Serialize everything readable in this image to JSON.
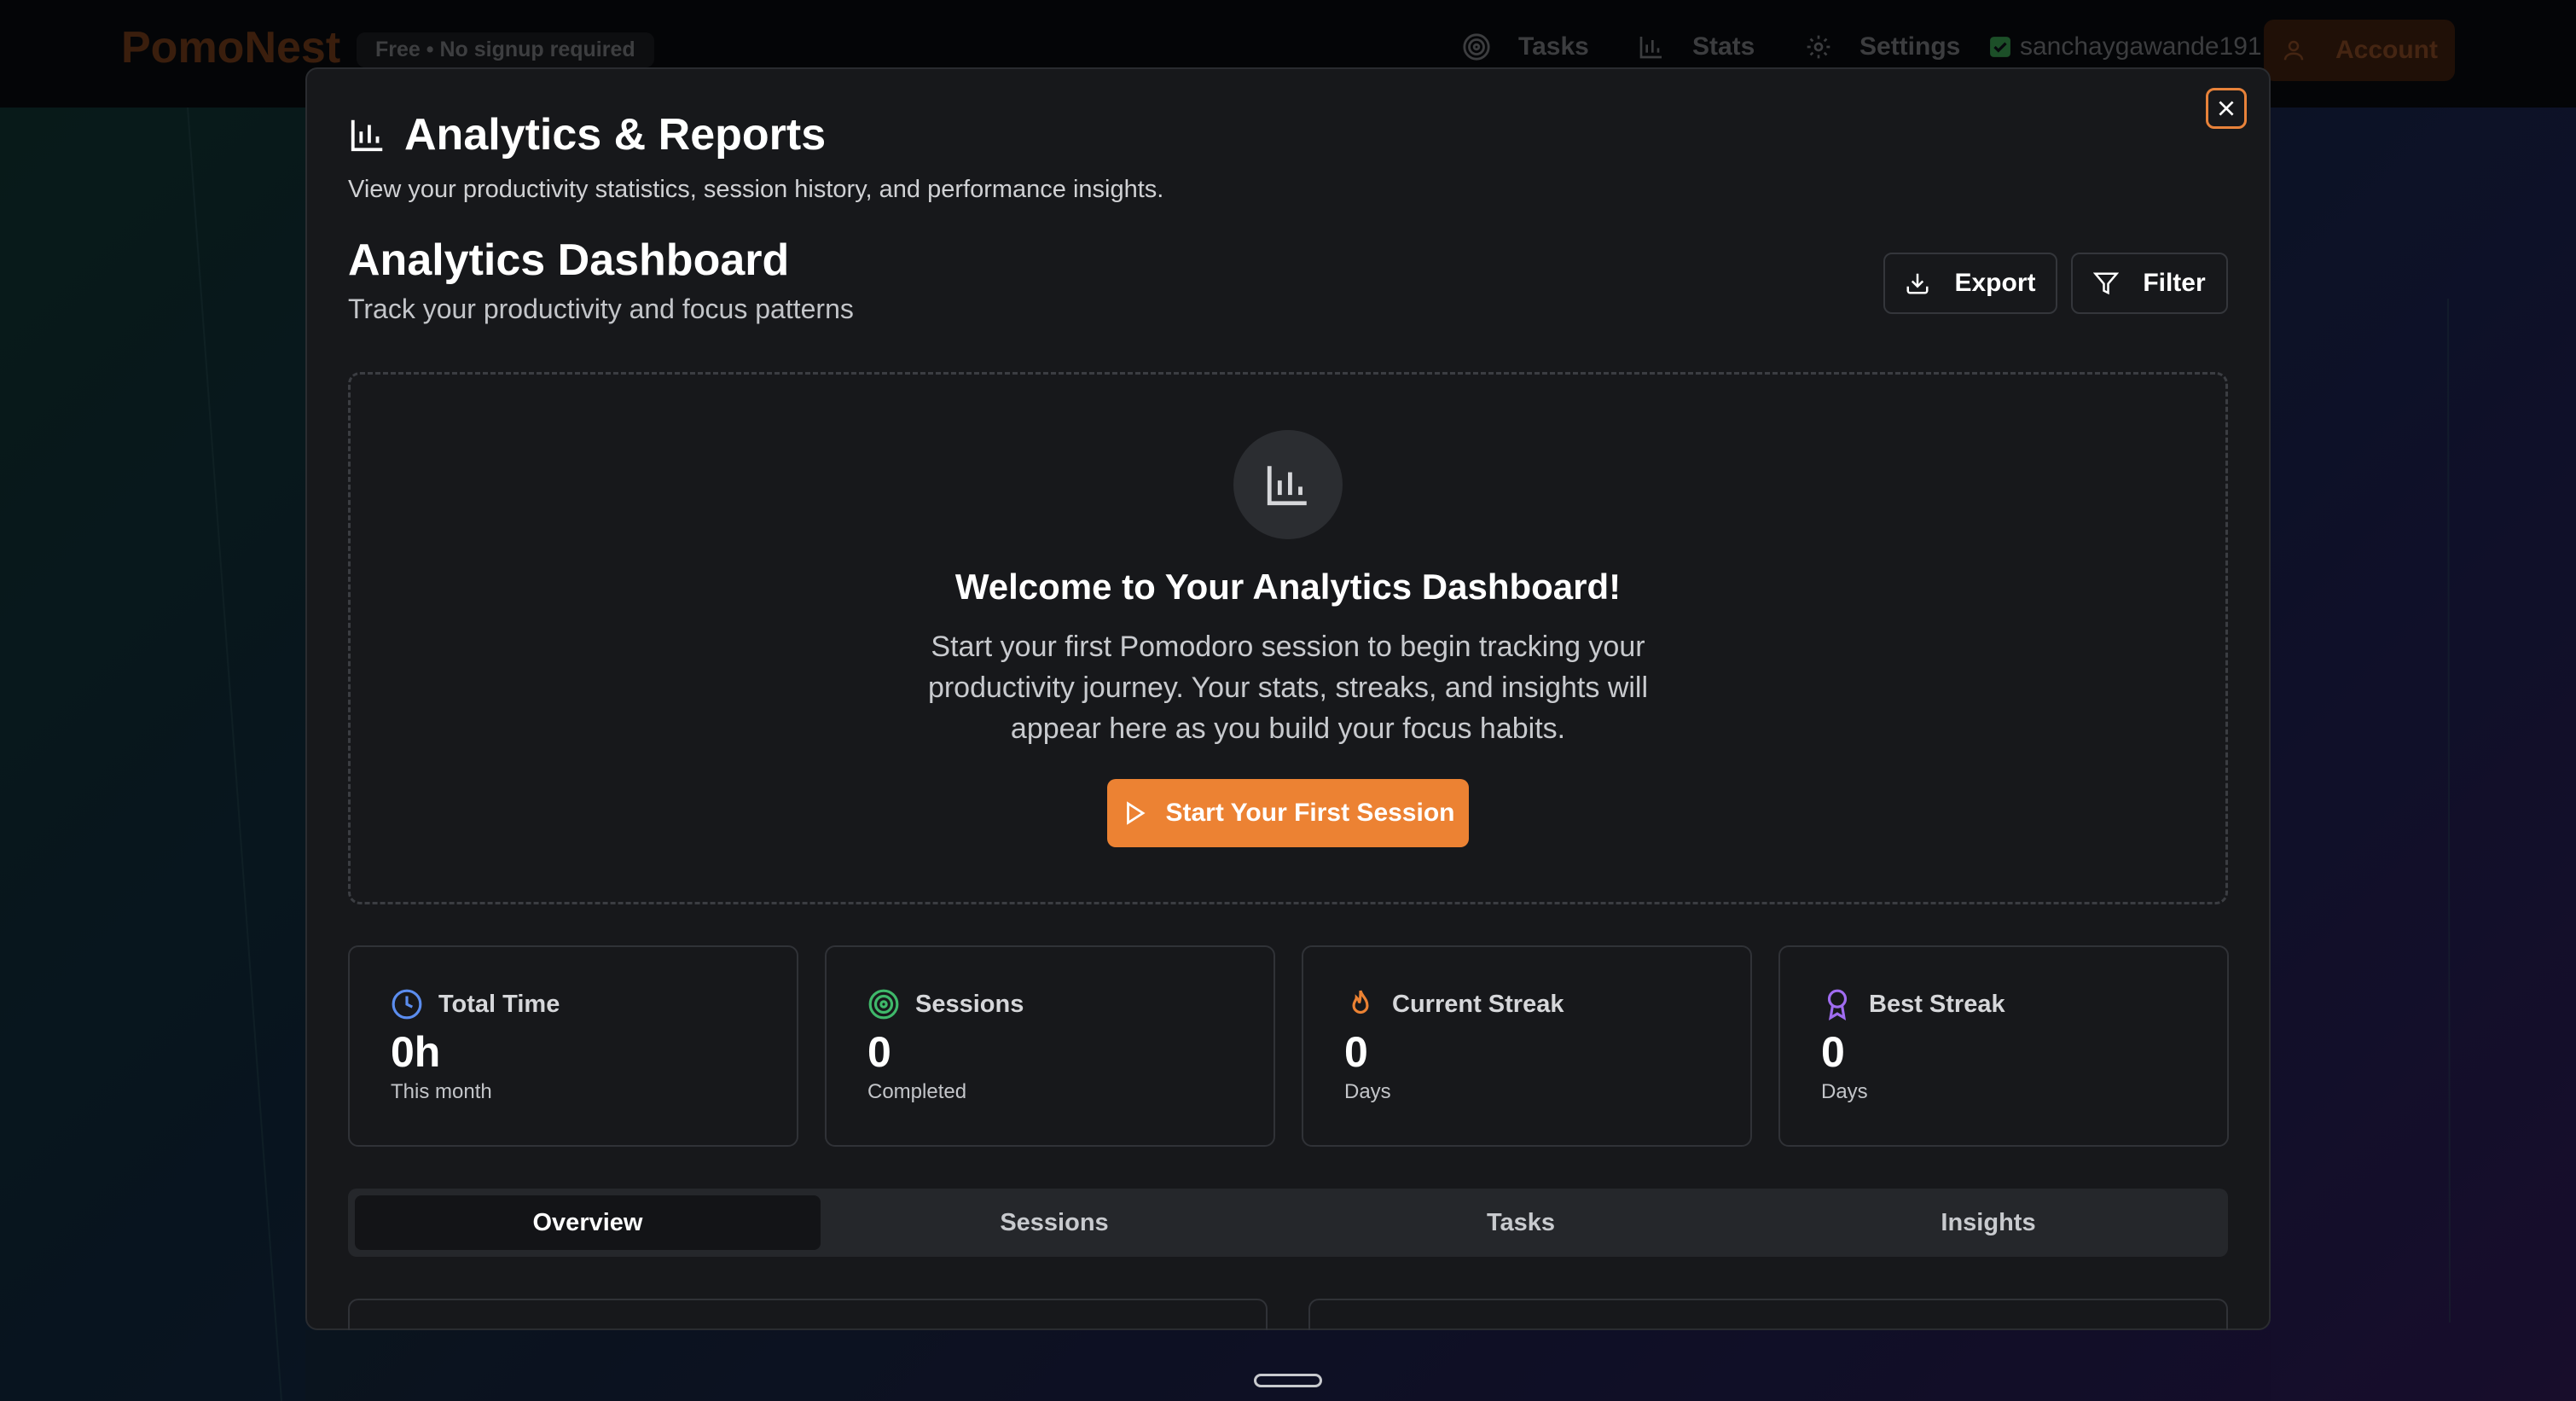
{
  "app": {
    "brand": "PomoNest",
    "tagline": "Free • No signup required",
    "nav": [
      {
        "label": "Tasks",
        "icon": "target-icon"
      },
      {
        "label": "Stats",
        "icon": "bar-chart-icon"
      },
      {
        "label": "Settings",
        "icon": "gear-icon"
      }
    ],
    "username": "sanchaygawande191",
    "account_label": "Account"
  },
  "modal": {
    "title": "Analytics & Reports",
    "subtitle": "View your productivity statistics, session history, and performance insights.",
    "dashboard_title": "Analytics Dashboard",
    "dashboard_subtitle": "Track your productivity and focus patterns",
    "export_label": "Export",
    "filter_label": "Filter",
    "welcome": {
      "title": "Welcome to Your Analytics Dashboard!",
      "text": "Start your first Pomodoro session to begin tracking your productivity journey. Your stats, streaks, and insights will appear here as you build your focus habits.",
      "button_label": "Start Your First Session"
    },
    "stats": [
      {
        "label": "Total Time",
        "value": "0h",
        "caption": "This month",
        "icon": "clock-icon",
        "color": "#5b8def"
      },
      {
        "label": "Sessions",
        "value": "0",
        "caption": "Completed",
        "icon": "target-icon",
        "color": "#3fb86a"
      },
      {
        "label": "Current Streak",
        "value": "0",
        "caption": "Days",
        "icon": "flame-icon",
        "color": "#ec8233"
      },
      {
        "label": "Best Streak",
        "value": "0",
        "caption": "Days",
        "icon": "award-icon",
        "color": "#a06cf0"
      }
    ],
    "tabs": [
      "Overview",
      "Sessions",
      "Tasks",
      "Insights"
    ],
    "active_tab": "Overview"
  },
  "colors": {
    "accent": "#ec8233",
    "modal_bg": "#17181b"
  }
}
